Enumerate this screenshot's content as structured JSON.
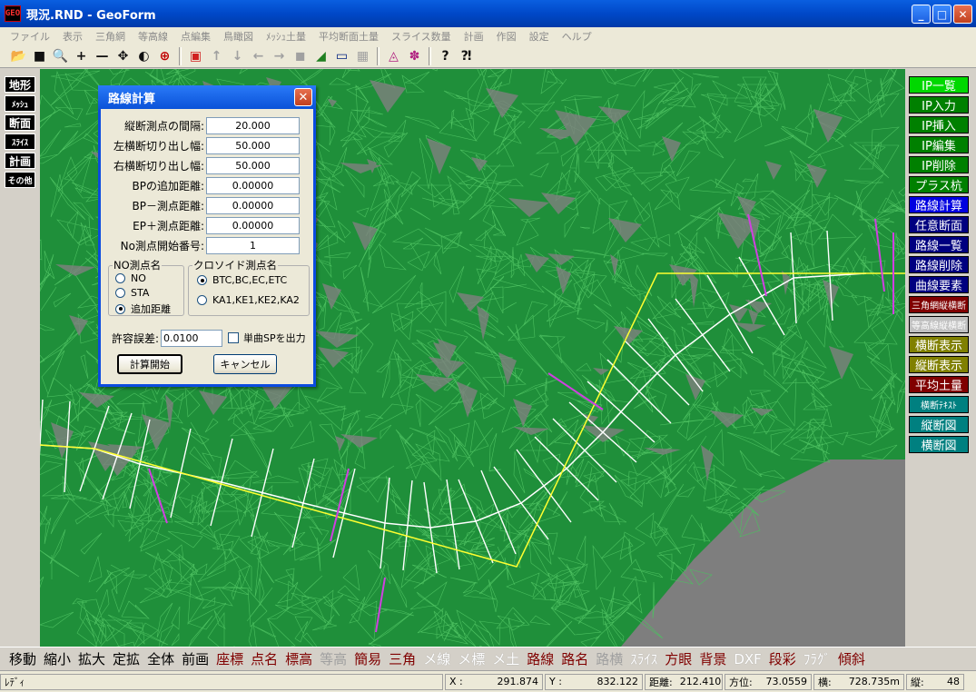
{
  "window": {
    "title": "現況.RND - GeoForm",
    "app_icon_text": "GEO",
    "min_label": "_",
    "max_label": "□",
    "close_label": "✕"
  },
  "menu": [
    "ファイル",
    "表示",
    "三角網",
    "等高線",
    "点編集",
    "鳥瞰図",
    "ﾒｯｼｭ土量",
    "平均断面土量",
    "スライス数量",
    "計画",
    "作図",
    "設定",
    "ヘルプ"
  ],
  "toolbar": {
    "icons": [
      "open-folder-icon",
      "save-icon",
      "zoom-search-icon",
      "plus-icon",
      "minus-icon",
      "move-icon",
      "rotate-icon",
      "zoom-window-icon",
      "separator",
      "cube-icon",
      "arrow-up-icon",
      "arrow-down-icon",
      "arrow-left-icon",
      "arrow-right-icon",
      "box-icon",
      "chart-icon",
      "window-icon",
      "grid-icon",
      "separator",
      "terrain-icon",
      "terrain2-icon",
      "separator",
      "help-icon",
      "help-pointer-icon"
    ]
  },
  "left_panel": {
    "buttons": [
      "地形",
      "ﾒｯｼｭ",
      "断面",
      "ｽﾗｲｽ",
      "計画",
      "その他"
    ]
  },
  "right_panel": {
    "buttons": [
      {
        "label": "IP一覧",
        "bg": "#00d800",
        "fg": "#ffffff"
      },
      {
        "label": "IP入力",
        "bg": "#008000",
        "fg": "#ffffff"
      },
      {
        "label": "IP挿入",
        "bg": "#008000",
        "fg": "#ffffff"
      },
      {
        "label": "IP編集",
        "bg": "#008000",
        "fg": "#ffffff"
      },
      {
        "label": "IP削除",
        "bg": "#008000",
        "fg": "#ffffff"
      },
      {
        "label": "プラス杭",
        "bg": "#008000",
        "fg": "#ffffff"
      },
      {
        "label": "路線計算",
        "bg": "#0000e0",
        "fg": "#ffffff"
      },
      {
        "label": "任意断面",
        "bg": "#000080",
        "fg": "#ffffff"
      },
      {
        "label": "路線一覧",
        "bg": "#000080",
        "fg": "#ffffff"
      },
      {
        "label": "路線削除",
        "bg": "#000080",
        "fg": "#ffffff"
      },
      {
        "label": "曲線要素",
        "bg": "#000080",
        "fg": "#ffffff"
      },
      {
        "label": "三角網縦横断",
        "bg": "#800000",
        "fg": "#ffffff"
      },
      {
        "label": "等高線縦横断",
        "bg": "#c0c0c0",
        "fg": "#ffffff"
      },
      {
        "label": "横断表示",
        "bg": "#808000",
        "fg": "#ffffff"
      },
      {
        "label": "縦断表示",
        "bg": "#808000",
        "fg": "#ffffff"
      },
      {
        "label": "平均土量",
        "bg": "#800000",
        "fg": "#ffffff"
      },
      {
        "label": "横断ﾃｷｽﾄ",
        "bg": "#008080",
        "fg": "#ffffff"
      },
      {
        "label": "縦断図",
        "bg": "#008080",
        "fg": "#ffffff"
      },
      {
        "label": "横断図",
        "bg": "#008080",
        "fg": "#ffffff"
      }
    ]
  },
  "bottom_bar": [
    {
      "label": "移動",
      "color": "#000000"
    },
    {
      "label": "縮小",
      "color": "#000000"
    },
    {
      "label": "拡大",
      "color": "#000000"
    },
    {
      "label": "定拡",
      "color": "#000000"
    },
    {
      "label": "全体",
      "color": "#000000"
    },
    {
      "label": "前画",
      "color": "#000000"
    },
    {
      "label": "座標",
      "color": "#800000"
    },
    {
      "label": "点名",
      "color": "#800000"
    },
    {
      "label": "標高",
      "color": "#800000"
    },
    {
      "label": "等高",
      "color": "#a0a0a0"
    },
    {
      "label": "簡易",
      "color": "#800000"
    },
    {
      "label": "三角",
      "color": "#800000"
    },
    {
      "label": "メ線",
      "color": "#ffffff"
    },
    {
      "label": "メ標",
      "color": "#ffffff"
    },
    {
      "label": "メ土",
      "color": "#ffffff"
    },
    {
      "label": "路線",
      "color": "#800000"
    },
    {
      "label": "路名",
      "color": "#800000"
    },
    {
      "label": "路横",
      "color": "#a0a0a0"
    },
    {
      "label": "ｽﾗｲｽ",
      "color": "#ffffff"
    },
    {
      "label": "方眼",
      "color": "#800000"
    },
    {
      "label": "背景",
      "color": "#800000"
    },
    {
      "label": "DXF",
      "color": "#ffffff"
    },
    {
      "label": "段彩",
      "color": "#800000"
    },
    {
      "label": "ﾌﾗｸﾞ",
      "color": "#ffffff"
    },
    {
      "label": "傾斜",
      "color": "#800000"
    }
  ],
  "status": {
    "ready": "ﾚﾃﾞｨ",
    "x_label": "X :",
    "x_value": "291.874",
    "y_label": "Y :",
    "y_value": "832.122",
    "dist_label": "距離:",
    "dist_value": "212.410",
    "pos_label": "方位:",
    "pos_value": "73.0559",
    "h_label": "横:",
    "h_value": "728.735m",
    "v_label": "縦:",
    "v_value": "48"
  },
  "dialog": {
    "title": "路線計算",
    "fields": [
      {
        "label": "縦断測点の間隔:",
        "value": "20.000"
      },
      {
        "label": "左横断切り出し幅:",
        "value": "50.000"
      },
      {
        "label": "右横断切り出し幅:",
        "value": "50.000"
      },
      {
        "label": "BPの追加距離:",
        "value": "0.00000"
      },
      {
        "label": "BP－測点距離:",
        "value": "0.00000"
      },
      {
        "label": "EP＋測点距離:",
        "value": "0.00000"
      },
      {
        "label": "No測点開始番号:",
        "value": "1"
      }
    ],
    "no_group": {
      "legend": "NO測点名",
      "options": [
        {
          "label": "NO",
          "checked": false
        },
        {
          "label": "STA",
          "checked": false
        },
        {
          "label": "追加距離",
          "checked": true
        }
      ]
    },
    "clothoid_group": {
      "legend": "クロソイド測点名",
      "options": [
        {
          "label": "BTC,BC,EC,ETC",
          "checked": true
        },
        {
          "label": "KA1,KE1,KE2,KA2",
          "checked": false
        }
      ]
    },
    "tolerance_label": "許容誤差:",
    "tolerance_value": "0.0100",
    "single_curve_label": "単曲SPを出力",
    "start_button": "計算開始",
    "cancel_button": "キャンセル"
  }
}
